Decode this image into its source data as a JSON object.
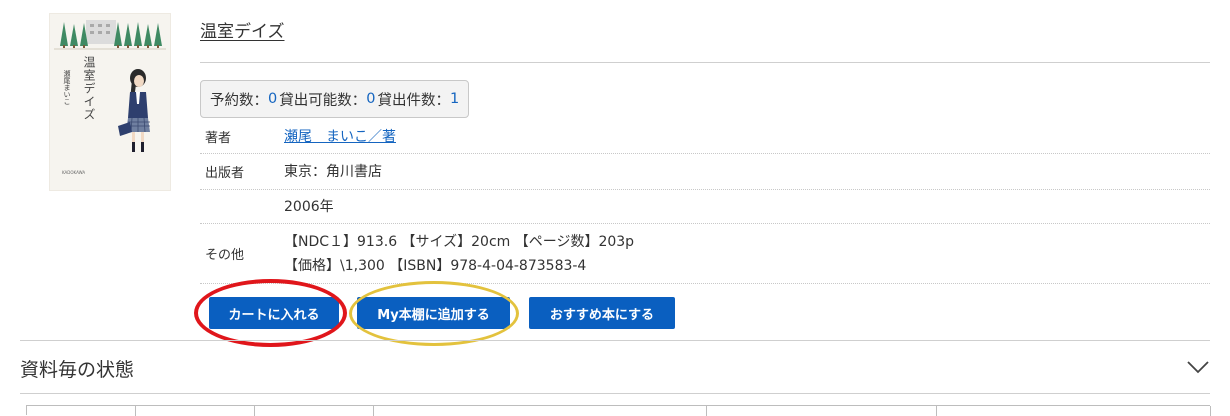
{
  "book": {
    "cover_title": "温室デイズ",
    "cover_author": "瀬尾まいこ",
    "title": "温室デイズ",
    "counts": {
      "reserve_label": "予約数：",
      "reserve_value": "0",
      "loanable_label": "貸出可能数：",
      "loanable_value": "0",
      "loaned_label": "貸出件数：",
      "loaned_value": "1"
    },
    "author_label": "著者",
    "author_value": "瀬尾　まいこ／著",
    "publisher_label": "出版者",
    "publisher_value": "東京：角川書店",
    "year_label": "",
    "year_value": "2006年",
    "other_label": "その他",
    "other_line1": "【NDC１】913.6 【サイズ】20cm 【ページ数】203p",
    "other_line2": "【価格】\\1,300 【ISBN】978-4-04-873583-4"
  },
  "actions": {
    "cart": "カートに入れる",
    "shelf": "My本棚に追加する",
    "recommend": "おすすめ本にする"
  },
  "section": {
    "title": "資料毎の状態"
  },
  "colors": {
    "button": "#0a5fc0",
    "link": "#1565c0",
    "highlight_red": "#e0161b",
    "highlight_yellow": "#e3c23d"
  }
}
